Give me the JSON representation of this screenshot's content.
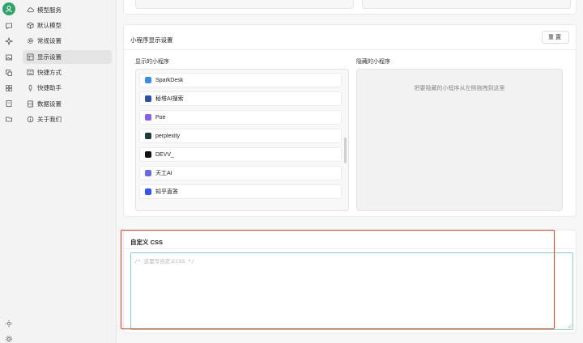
{
  "sidebar": {
    "items": [
      {
        "label": "模型服务",
        "icon": "cloud-icon"
      },
      {
        "label": "默认模型",
        "icon": "cube-icon"
      },
      {
        "label": "常规设置",
        "icon": "gear-icon"
      },
      {
        "label": "显示设置",
        "icon": "layout-icon",
        "active": true
      },
      {
        "label": "快捷方式",
        "icon": "keyboard-icon"
      },
      {
        "label": "快捷助手",
        "icon": "rocket-icon"
      },
      {
        "label": "数据设置",
        "icon": "database-icon"
      },
      {
        "label": "关于我们",
        "icon": "info-icon"
      }
    ]
  },
  "mini_apps": {
    "title": "小程序显示设置",
    "reset_label": "重置",
    "visible_label": "显示的小程序",
    "hidden_label": "隐藏的小程序",
    "hidden_hint": "把要隐藏的小程序从左侧拖拽到这里",
    "visible_apps": [
      {
        "name": "SparkDesk",
        "color": "#3a8ee6"
      },
      {
        "name": "秘塔AI搜索",
        "color": "#2b4fa8"
      },
      {
        "name": "Poe",
        "color": "#8a5cf6"
      },
      {
        "name": "perplexity",
        "color": "#1f3a3a"
      },
      {
        "name": "DEVV_",
        "color": "#111111"
      },
      {
        "name": "天工AI",
        "color": "#6a6ae0"
      },
      {
        "name": "知乎直答",
        "color": "#3355ff"
      }
    ]
  },
  "custom_css": {
    "title": "自定义 CSS",
    "placeholder": "/* 这里写自定义CSS */"
  },
  "colors": {
    "accent": "#2fa36b",
    "highlight": "#e53a2a",
    "editor_border": "#8fd0bd"
  }
}
